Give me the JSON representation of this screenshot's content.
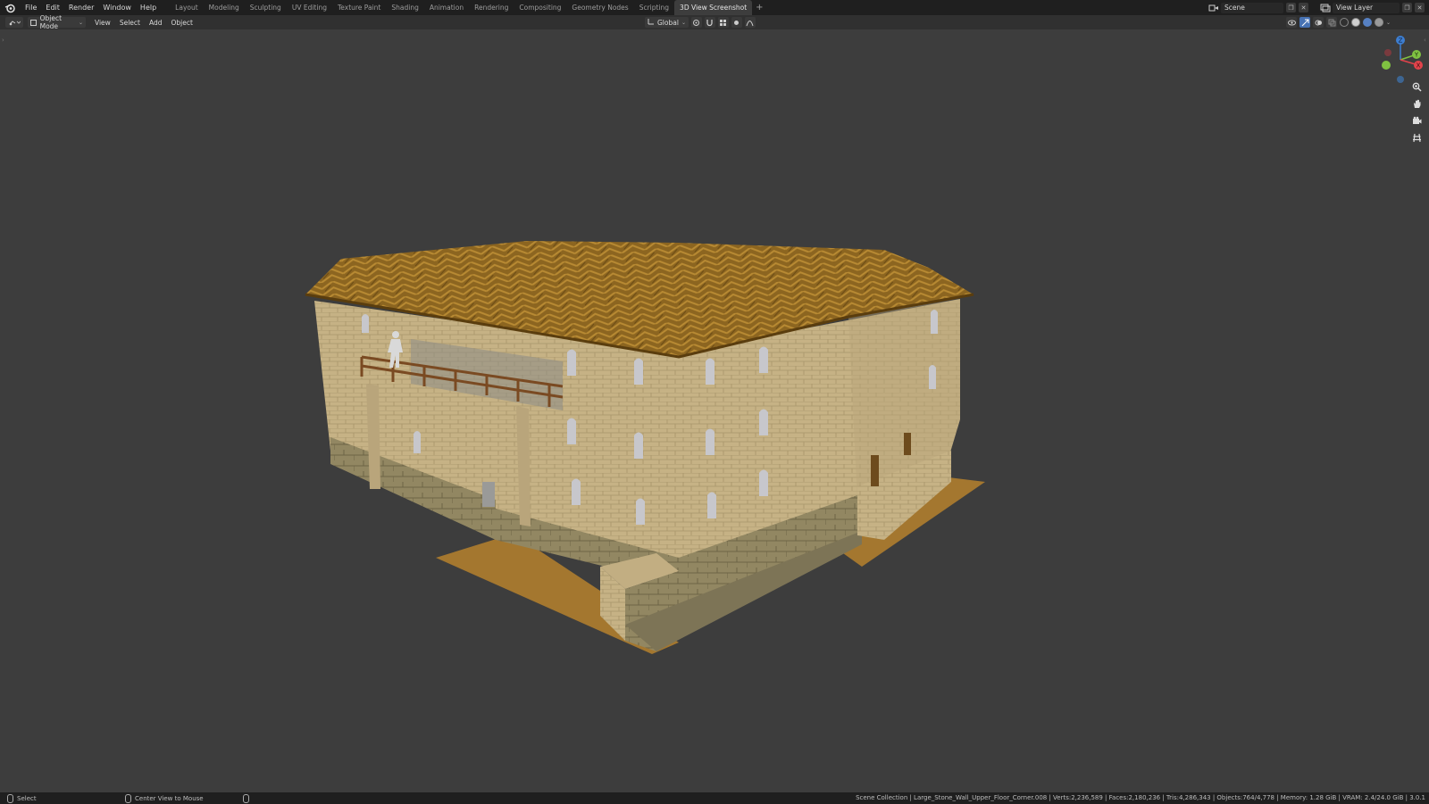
{
  "app": {
    "menu": [
      "File",
      "Edit",
      "Render",
      "Window",
      "Help"
    ],
    "workspaces": [
      "Layout",
      "Modeling",
      "Sculpting",
      "UV Editing",
      "Texture Paint",
      "Shading",
      "Animation",
      "Rendering",
      "Compositing",
      "Geometry Nodes",
      "Scripting",
      "3D View Screenshot"
    ],
    "active_workspace": "3D View Screenshot",
    "add_workspace": "+",
    "scene_name": "Scene",
    "view_layer_name": "View Layer"
  },
  "header": {
    "mode": "Object Mode",
    "menus": [
      "View",
      "Select",
      "Add",
      "Object"
    ],
    "orientation": "Global"
  },
  "statusbar": {
    "left_action": "Select",
    "middle_action": "Center View to Mouse",
    "stats": "Scene Collection | Large_Stone_Wall_Upper_Floor_Corner.008 | Verts:2,236,589 | Faces:2,180,236 | Tris:4,286,343 | Objects:764/4,778 | Memory: 1.28 GiB | VRAM: 2.4/24.0 GiB | 3.0.1"
  },
  "gizmo": {
    "axes": {
      "x": "X",
      "y": "Y",
      "z": "Z"
    },
    "colors": {
      "x": "#e2434b",
      "y": "#7fc241",
      "z": "#3d7ed1"
    }
  },
  "colors": {
    "viewport_bg": "#3d3d3d",
    "topbar_bg": "#1f1f1f",
    "header_bg": "#303030",
    "active_blue": "#4772b3",
    "roof": "#8a6420",
    "stone": "#c8b487",
    "ground": "#a87a3a"
  },
  "icons": [
    "blender-logo-icon",
    "editor-type-icon",
    "object-mode-icon",
    "orientation-icon",
    "pivot-icon",
    "snap-icon",
    "proportional-icon",
    "visibility-icon",
    "gizmo-icon",
    "overlay-icon",
    "xray-icon",
    "zoom-icon",
    "hand-icon",
    "camera-icon",
    "grid-icon",
    "mouse-icon"
  ]
}
